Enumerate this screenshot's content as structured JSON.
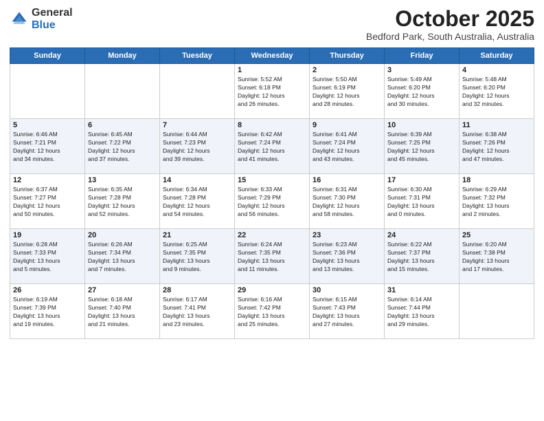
{
  "logo": {
    "general": "General",
    "blue": "Blue"
  },
  "title": "October 2025",
  "subtitle": "Bedford Park, South Australia, Australia",
  "days_of_week": [
    "Sunday",
    "Monday",
    "Tuesday",
    "Wednesday",
    "Thursday",
    "Friday",
    "Saturday"
  ],
  "weeks": [
    [
      {
        "day": "",
        "info": ""
      },
      {
        "day": "",
        "info": ""
      },
      {
        "day": "",
        "info": ""
      },
      {
        "day": "1",
        "info": "Sunrise: 5:52 AM\nSunset: 6:18 PM\nDaylight: 12 hours\nand 26 minutes."
      },
      {
        "day": "2",
        "info": "Sunrise: 5:50 AM\nSunset: 6:19 PM\nDaylight: 12 hours\nand 28 minutes."
      },
      {
        "day": "3",
        "info": "Sunrise: 5:49 AM\nSunset: 6:20 PM\nDaylight: 12 hours\nand 30 minutes."
      },
      {
        "day": "4",
        "info": "Sunrise: 5:48 AM\nSunset: 6:20 PM\nDaylight: 12 hours\nand 32 minutes."
      }
    ],
    [
      {
        "day": "5",
        "info": "Sunrise: 6:46 AM\nSunset: 7:21 PM\nDaylight: 12 hours\nand 34 minutes."
      },
      {
        "day": "6",
        "info": "Sunrise: 6:45 AM\nSunset: 7:22 PM\nDaylight: 12 hours\nand 37 minutes."
      },
      {
        "day": "7",
        "info": "Sunrise: 6:44 AM\nSunset: 7:23 PM\nDaylight: 12 hours\nand 39 minutes."
      },
      {
        "day": "8",
        "info": "Sunrise: 6:42 AM\nSunset: 7:24 PM\nDaylight: 12 hours\nand 41 minutes."
      },
      {
        "day": "9",
        "info": "Sunrise: 6:41 AM\nSunset: 7:24 PM\nDaylight: 12 hours\nand 43 minutes."
      },
      {
        "day": "10",
        "info": "Sunrise: 6:39 AM\nSunset: 7:25 PM\nDaylight: 12 hours\nand 45 minutes."
      },
      {
        "day": "11",
        "info": "Sunrise: 6:38 AM\nSunset: 7:26 PM\nDaylight: 12 hours\nand 47 minutes."
      }
    ],
    [
      {
        "day": "12",
        "info": "Sunrise: 6:37 AM\nSunset: 7:27 PM\nDaylight: 12 hours\nand 50 minutes."
      },
      {
        "day": "13",
        "info": "Sunrise: 6:35 AM\nSunset: 7:28 PM\nDaylight: 12 hours\nand 52 minutes."
      },
      {
        "day": "14",
        "info": "Sunrise: 6:34 AM\nSunset: 7:28 PM\nDaylight: 12 hours\nand 54 minutes."
      },
      {
        "day": "15",
        "info": "Sunrise: 6:33 AM\nSunset: 7:29 PM\nDaylight: 12 hours\nand 56 minutes."
      },
      {
        "day": "16",
        "info": "Sunrise: 6:31 AM\nSunset: 7:30 PM\nDaylight: 12 hours\nand 58 minutes."
      },
      {
        "day": "17",
        "info": "Sunrise: 6:30 AM\nSunset: 7:31 PM\nDaylight: 13 hours\nand 0 minutes."
      },
      {
        "day": "18",
        "info": "Sunrise: 6:29 AM\nSunset: 7:32 PM\nDaylight: 13 hours\nand 2 minutes."
      }
    ],
    [
      {
        "day": "19",
        "info": "Sunrise: 6:28 AM\nSunset: 7:33 PM\nDaylight: 13 hours\nand 5 minutes."
      },
      {
        "day": "20",
        "info": "Sunrise: 6:26 AM\nSunset: 7:34 PM\nDaylight: 13 hours\nand 7 minutes."
      },
      {
        "day": "21",
        "info": "Sunrise: 6:25 AM\nSunset: 7:35 PM\nDaylight: 13 hours\nand 9 minutes."
      },
      {
        "day": "22",
        "info": "Sunrise: 6:24 AM\nSunset: 7:35 PM\nDaylight: 13 hours\nand 11 minutes."
      },
      {
        "day": "23",
        "info": "Sunrise: 6:23 AM\nSunset: 7:36 PM\nDaylight: 13 hours\nand 13 minutes."
      },
      {
        "day": "24",
        "info": "Sunrise: 6:22 AM\nSunset: 7:37 PM\nDaylight: 13 hours\nand 15 minutes."
      },
      {
        "day": "25",
        "info": "Sunrise: 6:20 AM\nSunset: 7:38 PM\nDaylight: 13 hours\nand 17 minutes."
      }
    ],
    [
      {
        "day": "26",
        "info": "Sunrise: 6:19 AM\nSunset: 7:39 PM\nDaylight: 13 hours\nand 19 minutes."
      },
      {
        "day": "27",
        "info": "Sunrise: 6:18 AM\nSunset: 7:40 PM\nDaylight: 13 hours\nand 21 minutes."
      },
      {
        "day": "28",
        "info": "Sunrise: 6:17 AM\nSunset: 7:41 PM\nDaylight: 13 hours\nand 23 minutes."
      },
      {
        "day": "29",
        "info": "Sunrise: 6:16 AM\nSunset: 7:42 PM\nDaylight: 13 hours\nand 25 minutes."
      },
      {
        "day": "30",
        "info": "Sunrise: 6:15 AM\nSunset: 7:43 PM\nDaylight: 13 hours\nand 27 minutes."
      },
      {
        "day": "31",
        "info": "Sunrise: 6:14 AM\nSunset: 7:44 PM\nDaylight: 13 hours\nand 29 minutes."
      },
      {
        "day": "",
        "info": ""
      }
    ]
  ]
}
